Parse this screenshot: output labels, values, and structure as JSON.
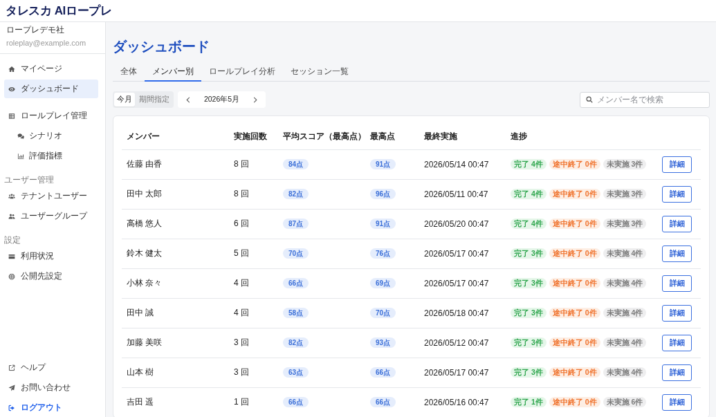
{
  "header": {
    "logo": "タレスカ AIロープレ"
  },
  "sidebar": {
    "account": {
      "company": "ロープレデモ社",
      "email": "roleplay@example.com"
    },
    "sections": [
      {
        "items": [
          {
            "label": "マイページ",
            "selected": false
          },
          {
            "label": "ダッシュボード",
            "selected": true
          }
        ]
      },
      {
        "items": [
          {
            "label": "ロールプレイ管理",
            "selected": false,
            "children": [
              {
                "label": "シナリオ",
                "selected": false
              },
              {
                "label": "評価指標",
                "selected": false
              }
            ]
          }
        ]
      },
      {
        "heading": "ユーザー管理",
        "items": [
          {
            "label": "テナントユーザー",
            "selected": false
          },
          {
            "label": "ユーザーグループ",
            "selected": false
          }
        ]
      },
      {
        "heading": "設定",
        "items": [
          {
            "label": "利用状況",
            "selected": false
          },
          {
            "label": "公開先設定",
            "selected": false
          }
        ]
      }
    ],
    "footer_links": [
      {
        "label": "ヘルプ"
      },
      {
        "label": "お問い合わせ"
      }
    ],
    "logout": {
      "label": "ログアウト"
    }
  },
  "page_title": "ダッシュボード",
  "tabs": [
    {
      "label": "全体",
      "selected": false
    },
    {
      "label": "メンバー別",
      "selected": true
    },
    {
      "label": "ロールプレイ分析",
      "selected": false
    },
    {
      "label": "セッション一覧",
      "selected": false
    }
  ],
  "period_filter": {
    "options": [
      {
        "label": "今月",
        "selected": true
      },
      {
        "label": "期間指定",
        "selected": false
      }
    ],
    "month": "2026年5月"
  },
  "search": {
    "placeholder": "メンバー名で検索"
  },
  "table": {
    "columns": [
      "メンバー",
      "実施回数",
      "平均スコア（最高点）",
      "最高点",
      "最終実施",
      "進捗"
    ],
    "rows": [
      {
        "member": "佐藤 由香",
        "sessions": "8 回",
        "avg_score": "84点",
        "max_score": "91点",
        "last_session": "2026/05/14 00:47",
        "progress": [
          {
            "kind": "completed",
            "label": "完了 4件"
          },
          {
            "kind": "aborted",
            "label": "途中終了 0件"
          },
          {
            "kind": "not_started",
            "label": "未実施 3件"
          }
        ],
        "action": "詳細"
      },
      {
        "member": "田中 太郎",
        "sessions": "8 回",
        "avg_score": "82点",
        "max_score": "96点",
        "last_session": "2026/05/11 00:47",
        "progress": [
          {
            "kind": "completed",
            "label": "完了 4件"
          },
          {
            "kind": "aborted",
            "label": "途中終了 0件"
          },
          {
            "kind": "not_started",
            "label": "未実施 3件"
          }
        ],
        "action": "詳細"
      },
      {
        "member": "高橋 悠人",
        "sessions": "6 回",
        "avg_score": "87点",
        "max_score": "91点",
        "last_session": "2026/05/20 00:47",
        "progress": [
          {
            "kind": "completed",
            "label": "完了 4件"
          },
          {
            "kind": "aborted",
            "label": "途中終了 0件"
          },
          {
            "kind": "not_started",
            "label": "未実施 3件"
          }
        ],
        "action": "詳細"
      },
      {
        "member": "鈴木 健太",
        "sessions": "5 回",
        "avg_score": "70点",
        "max_score": "76点",
        "last_session": "2026/05/17 00:47",
        "progress": [
          {
            "kind": "completed",
            "label": "完了 3件"
          },
          {
            "kind": "aborted",
            "label": "途中終了 0件"
          },
          {
            "kind": "not_started",
            "label": "未実施 4件"
          }
        ],
        "action": "詳細"
      },
      {
        "member": "小林 奈々",
        "sessions": "4 回",
        "avg_score": "66点",
        "max_score": "69点",
        "last_session": "2026/05/17 00:47",
        "progress": [
          {
            "kind": "completed",
            "label": "完了 3件"
          },
          {
            "kind": "aborted",
            "label": "途中終了 0件"
          },
          {
            "kind": "not_started",
            "label": "未実施 4件"
          }
        ],
        "action": "詳細"
      },
      {
        "member": "田中 誠",
        "sessions": "4 回",
        "avg_score": "58点",
        "max_score": "70点",
        "last_session": "2026/05/18 00:47",
        "progress": [
          {
            "kind": "completed",
            "label": "完了 3件"
          },
          {
            "kind": "aborted",
            "label": "途中終了 0件"
          },
          {
            "kind": "not_started",
            "label": "未実施 4件"
          }
        ],
        "action": "詳細"
      },
      {
        "member": "加藤 美咲",
        "sessions": "3 回",
        "avg_score": "82点",
        "max_score": "93点",
        "last_session": "2026/05/12 00:47",
        "progress": [
          {
            "kind": "completed",
            "label": "完了 3件"
          },
          {
            "kind": "aborted",
            "label": "途中終了 0件"
          },
          {
            "kind": "not_started",
            "label": "未実施 4件"
          }
        ],
        "action": "詳細"
      },
      {
        "member": "山本 樹",
        "sessions": "3 回",
        "avg_score": "63点",
        "max_score": "66点",
        "last_session": "2026/05/17 00:47",
        "progress": [
          {
            "kind": "completed",
            "label": "完了 3件"
          },
          {
            "kind": "aborted",
            "label": "途中終了 0件"
          },
          {
            "kind": "not_started",
            "label": "未実施 4件"
          }
        ],
        "action": "詳細"
      },
      {
        "member": "吉田 遥",
        "sessions": "1 回",
        "avg_score": "66点",
        "max_score": "66点",
        "last_session": "2026/05/16 00:47",
        "progress": [
          {
            "kind": "completed",
            "label": "完了 1件"
          },
          {
            "kind": "aborted",
            "label": "途中終了 0件"
          },
          {
            "kind": "not_started",
            "label": "未実施 6件"
          }
        ],
        "action": "詳細"
      }
    ]
  }
}
